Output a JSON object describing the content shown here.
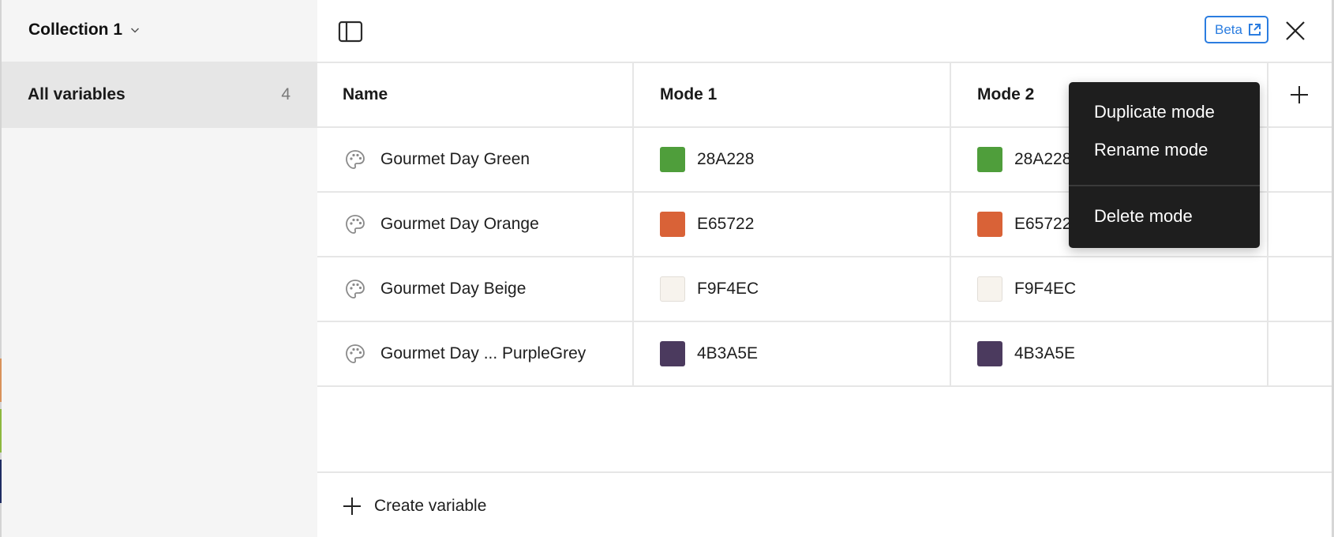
{
  "sidebar": {
    "collection_title": "Collection 1",
    "items": [
      {
        "label": "All variables",
        "count": "4"
      }
    ]
  },
  "topbar": {
    "beta_label": "Beta"
  },
  "table": {
    "headers": {
      "name": "Name",
      "mode1": "Mode 1",
      "mode2": "Mode 2"
    },
    "rows": [
      {
        "name": "Gourmet Day Green",
        "mode1": {
          "hex": "28A228",
          "color": "#4f9e3b"
        },
        "mode2": {
          "hex": "28A228",
          "color": "#4f9e3b"
        }
      },
      {
        "name": "Gourmet Day Orange",
        "mode1": {
          "hex": "E65722",
          "color": "#d96237"
        },
        "mode2": {
          "hex": "E65722",
          "color": "#d96237"
        }
      },
      {
        "name": "Gourmet Day Beige",
        "mode1": {
          "hex": "F9F4EC",
          "color": "#f7f3ed"
        },
        "mode2": {
          "hex": "F9F4EC",
          "color": "#f7f3ed"
        }
      },
      {
        "name": "Gourmet Day ...  PurpleGrey",
        "mode1": {
          "hex": "4B3A5E",
          "color": "#4b3a5e"
        },
        "mode2": {
          "hex": "4B3A5E",
          "color": "#4b3a5e"
        }
      }
    ]
  },
  "footer": {
    "create_label": "Create variable"
  },
  "context_menu": {
    "items": [
      "Duplicate mode",
      "Rename mode",
      "Delete mode"
    ]
  },
  "colors": {
    "accent": "#2b7de0",
    "menu_bg": "#1e1e1e",
    "strip_orange": "#d9925a",
    "strip_green": "#8db83f",
    "strip_navy": "#1f2d63"
  }
}
